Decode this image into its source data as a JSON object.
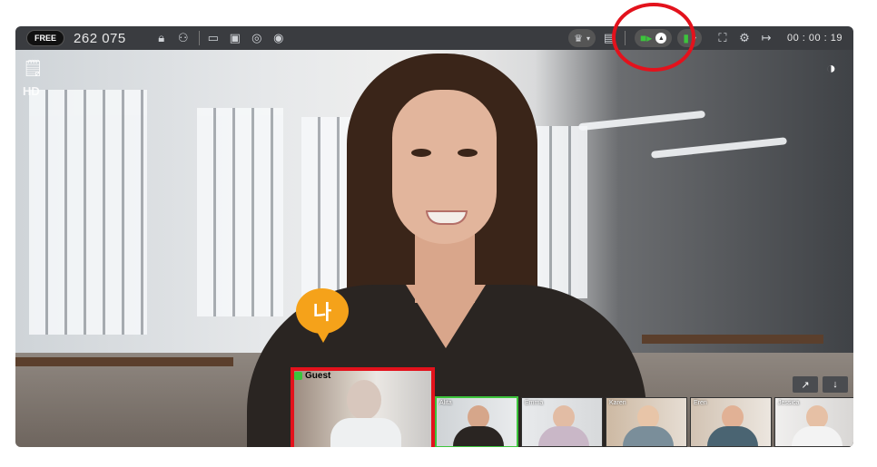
{
  "toolbar": {
    "plan_badge": "FREE",
    "room_id": "262 075",
    "timer": "00 : 00 : 19"
  },
  "overlay": {
    "hd_label": "HD",
    "marker_label": "나"
  },
  "participants": [
    {
      "name": "Guest",
      "highlighted": true
    },
    {
      "name": "Alita",
      "active_speaker": true
    },
    {
      "name": "Emma"
    },
    {
      "name": "Karen"
    },
    {
      "name": "Eren"
    },
    {
      "name": "Jessica"
    }
  ],
  "icons": {
    "top_left": [
      "lock-icon",
      "user-lock-icon",
      "screen-share-icon",
      "whiteboard-icon",
      "camera-capture-icon",
      "record-icon"
    ],
    "top_right": [
      "crown-icon",
      "layout-icon",
      "camera-icon",
      "mic-icon",
      "fullscreen-icon",
      "settings-icon",
      "exit-icon"
    ]
  },
  "colors": {
    "highlight": "#e3121c",
    "marker": "#f5a21a",
    "active": "#3cc43c",
    "toolbar": "#3a3c40"
  }
}
